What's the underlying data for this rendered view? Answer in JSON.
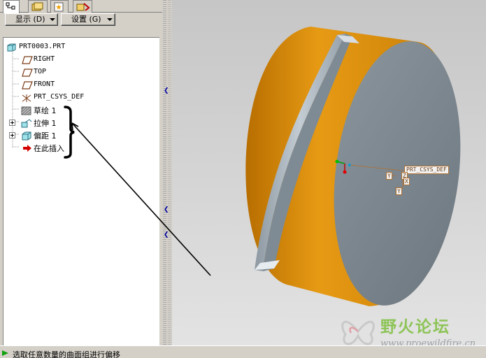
{
  "toolbar": {
    "display_menu": "显示 (D)",
    "settings_menu": "设置 (G)"
  },
  "model_tree": {
    "root": "PRT0003.PRT",
    "items": [
      {
        "label": "RIGHT",
        "icon": "datum-plane-icon"
      },
      {
        "label": "TOP",
        "icon": "datum-plane-icon"
      },
      {
        "label": "FRONT",
        "icon": "datum-plane-icon"
      },
      {
        "label": "PRT_CSYS_DEF",
        "icon": "coordinate-system-icon"
      },
      {
        "label": "草绘 1",
        "icon": "sketch-icon"
      },
      {
        "label": "拉伸 1",
        "icon": "extrude-icon"
      },
      {
        "label": "偏距 1",
        "icon": "offset-icon"
      },
      {
        "label": "在此插入",
        "icon": "insert-here-arrow-icon"
      }
    ]
  },
  "viewport": {
    "csys_label": "PRT_CSYS_DEF",
    "axis_labels": [
      "Y",
      "Z",
      "X",
      "Y"
    ]
  },
  "watermark": {
    "title": "野火论坛",
    "url": "www.proewildfire.cn"
  },
  "status": {
    "message": "选取任意数量的曲面组进行偏移"
  },
  "colors": {
    "orange_body": "#d98c0a",
    "face_gray": "#7b868f",
    "groove": "#a9b4bd",
    "background": "#d4d0c8"
  }
}
